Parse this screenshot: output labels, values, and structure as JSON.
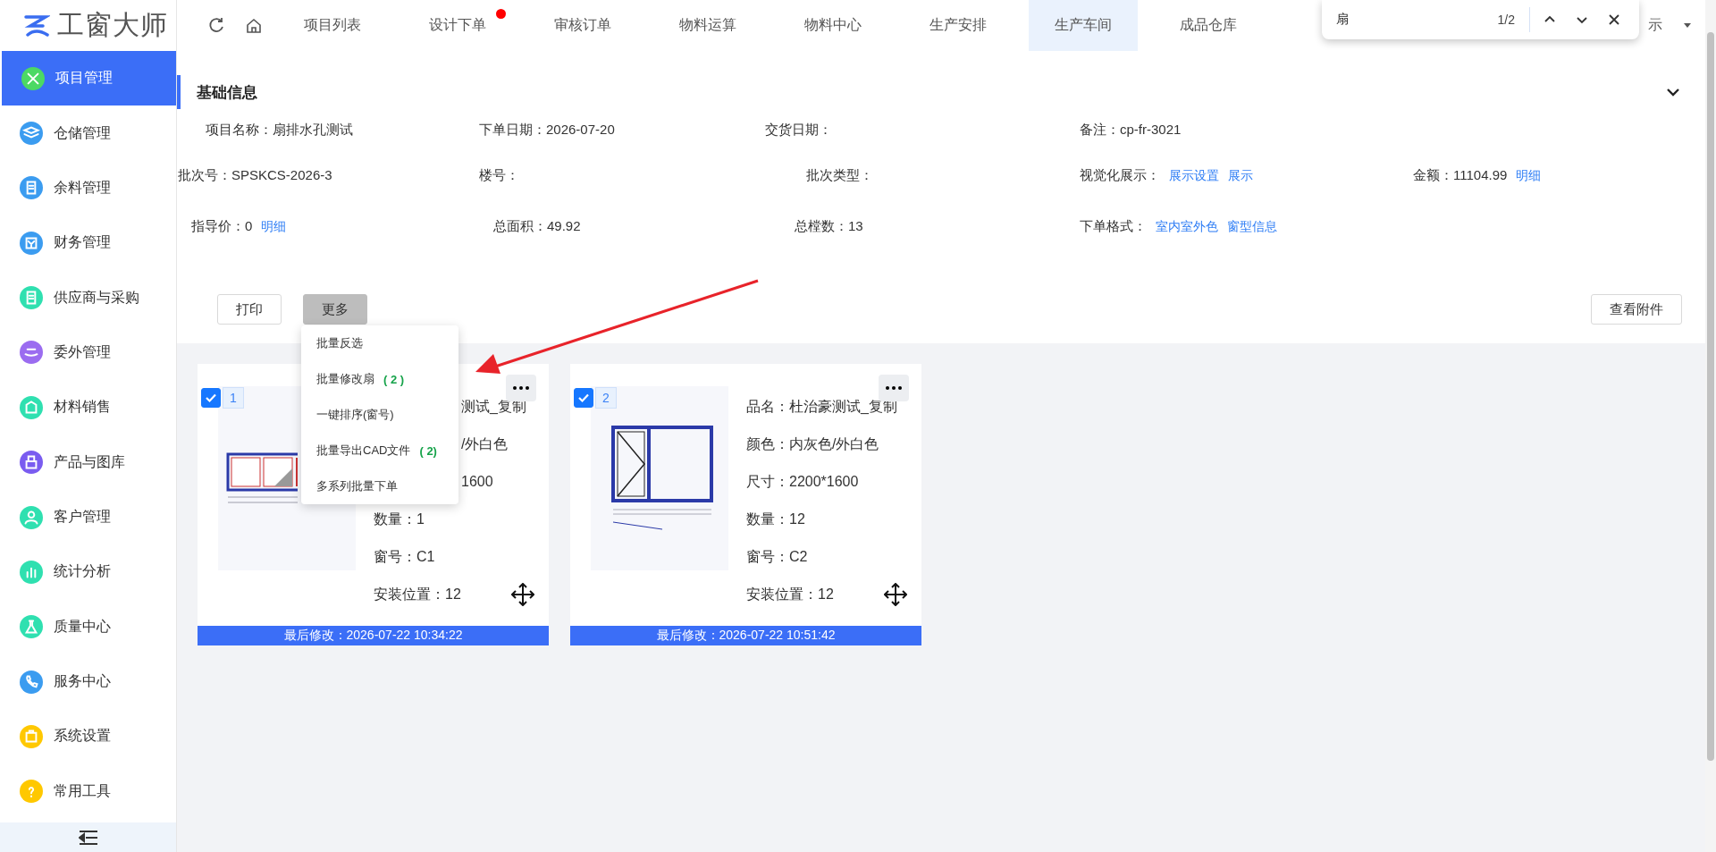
{
  "app": {
    "logo_text": "工窗大师"
  },
  "sidebar": {
    "items": [
      {
        "label": "项目管理",
        "selected": true,
        "color": "#4cd964"
      },
      {
        "label": "仓储管理",
        "selected": false,
        "color": "#3b9cf0"
      },
      {
        "label": "余料管理",
        "selected": false,
        "color": "#3b9cf0"
      },
      {
        "label": "财务管理",
        "selected": false,
        "color": "#3b9cf0"
      },
      {
        "label": "供应商与采购",
        "selected": false,
        "color": "#2fe0b0"
      },
      {
        "label": "委外管理",
        "selected": false,
        "color": "#9b6cf0"
      },
      {
        "label": "材料销售",
        "selected": false,
        "color": "#2fe0b0"
      },
      {
        "label": "产品与图库",
        "selected": false,
        "color": "#7a5cf0"
      },
      {
        "label": "客户管理",
        "selected": false,
        "color": "#2fe0b0"
      },
      {
        "label": "统计分析",
        "selected": false,
        "color": "#2fe0b0"
      },
      {
        "label": "质量中心",
        "selected": false,
        "color": "#2fe0b0"
      },
      {
        "label": "服务中心",
        "selected": false,
        "color": "#3b9cf0"
      },
      {
        "label": "系统设置",
        "selected": false,
        "color": "#ffc800"
      },
      {
        "label": "常用工具",
        "selected": false,
        "color": "#ffc800"
      }
    ]
  },
  "tabs": [
    {
      "label": "项目列表",
      "selected": false,
      "dot": false
    },
    {
      "label": "设计下单",
      "selected": false,
      "dot": true
    },
    {
      "label": "审核订单",
      "selected": false,
      "dot": false
    },
    {
      "label": "物料运算",
      "selected": false,
      "dot": false
    },
    {
      "label": "物料中心",
      "selected": false,
      "dot": false
    },
    {
      "label": "生产安排",
      "selected": false,
      "dot": false
    },
    {
      "label": "生产车间",
      "selected": true,
      "dot": false
    },
    {
      "label": "成品仓库",
      "selected": false,
      "dot": false
    }
  ],
  "tab_tail": "示",
  "find_bar": {
    "query": "扇",
    "count": "1/2"
  },
  "section": {
    "title": "基础信息",
    "rows": [
      [
        {
          "label": "项目名称：",
          "value": "扇排水孔测试"
        },
        {
          "label": "下单日期：",
          "value": "2026-07-20"
        },
        {
          "label": "交货日期："
        },
        {
          "label": "备注：",
          "value": "cp-fr-3021"
        }
      ],
      [
        {
          "label": "批次号：",
          "value": "SPSKCS-2026-3"
        },
        {
          "label": "楼号："
        },
        {
          "label": "批次类型："
        },
        {
          "label": "视觉化展示：",
          "links": [
            "展示设置",
            "展示"
          ]
        },
        {
          "label": "金额：",
          "value": "11104.99",
          "links": [
            "明细"
          ]
        }
      ],
      [
        {
          "label": "指导价：",
          "value": "0",
          "links": [
            "明细"
          ]
        },
        {
          "label": "总面积：",
          "value": "49.92"
        },
        {
          "label": "总樘数：",
          "value": "13"
        },
        {
          "label": "下单格式：",
          "links": [
            "室内室外色",
            "窗型信息"
          ]
        }
      ]
    ]
  },
  "toolbar": {
    "buttons": [
      {
        "label": "打印",
        "kind": "plain"
      },
      {
        "label": "更多",
        "kind": "menu"
      }
    ],
    "attachments_button": "查看附件"
  },
  "more_menu": {
    "items": [
      {
        "label": "批量反选"
      },
      {
        "label": "批量修改扇",
        "count": "( 2 )"
      },
      {
        "label": "一键排序(窗号)"
      },
      {
        "label": "批量导出CAD文件",
        "count": "( 2)"
      },
      {
        "label": "多系列批量下单"
      }
    ]
  },
  "cards": [
    {
      "index": "1",
      "checked": true,
      "kind": "strip",
      "rows": [
        {
          "text": "测试_复制",
          "kind": "cut"
        },
        {
          "text": "/外白色",
          "kind": "cut"
        },
        {
          "text": "1600",
          "kind": "cut"
        },
        {
          "text": "数量：1",
          "kind": "full"
        },
        {
          "text": "窗号：C1",
          "kind": "full"
        },
        {
          "text": "安装位置：12",
          "kind": "full"
        }
      ],
      "footer": "最后修改：2026-07-22 10:34:22"
    },
    {
      "index": "2",
      "checked": true,
      "kind": "casement",
      "rows": [
        {
          "text": "品名：杜治豪测试_复制",
          "kind": "full"
        },
        {
          "text": "颜色：内灰色/外白色",
          "kind": "full"
        },
        {
          "text": "尺寸：2200*1600",
          "kind": "full"
        },
        {
          "text": "数量：12",
          "kind": "full"
        },
        {
          "text": "窗号：C2",
          "kind": "full"
        },
        {
          "text": "安装位置：12",
          "kind": "full"
        }
      ],
      "footer": "最后修改：2026-07-22 10:51:42"
    }
  ]
}
